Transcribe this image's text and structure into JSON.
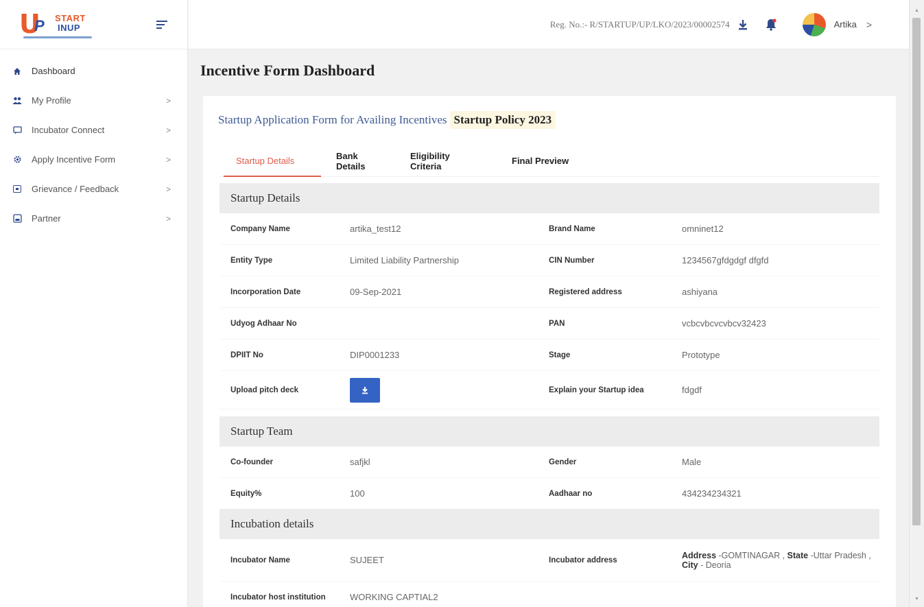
{
  "sidebar": {
    "logo": {
      "u": "U",
      "p": "P",
      "start": "START",
      "inup": "INUP"
    },
    "items": [
      {
        "label": "Dashboard",
        "icon": "home-icon",
        "has_chevron": false
      },
      {
        "label": "My Profile",
        "icon": "users-icon",
        "has_chevron": true
      },
      {
        "label": "Incubator Connect",
        "icon": "chat-icon",
        "has_chevron": true
      },
      {
        "label": "Apply Incentive Form",
        "icon": "gear-icon",
        "has_chevron": true
      },
      {
        "label": "Grievance / Feedback",
        "icon": "feedback-icon",
        "has_chevron": true
      },
      {
        "label": "Partner",
        "icon": "partner-icon",
        "has_chevron": true
      }
    ],
    "chevron": ">"
  },
  "header": {
    "reg_no": "Reg. No.:- R/STARTUP/UP/LKO/2023/00002574",
    "user_name": "Artika",
    "user_chevron": ">"
  },
  "page": {
    "title": "Incentive Form Dashboard",
    "form_title": "Startup Application Form for Availing Incentives",
    "policy": "Startup Policy 2023"
  },
  "tabs": [
    "Startup Details",
    "Bank Details",
    "Eligibility Criteria",
    "Final Preview"
  ],
  "startup_details": {
    "heading": "Startup Details",
    "rows": [
      {
        "l1": "Company Name",
        "v1": "artika_test12",
        "l2": "Brand Name",
        "v2": "omninet12"
      },
      {
        "l1": "Entity Type",
        "v1": "Limited Liability Partnership",
        "l2": "CIN Number",
        "v2": "1234567gfdgdgf dfgfd"
      },
      {
        "l1": "Incorporation Date",
        "v1": "09-Sep-2021",
        "l2": "Registered address",
        "v2": "ashiyana"
      },
      {
        "l1": "Udyog Adhaar No",
        "v1": "",
        "l2": "PAN",
        "v2": "vcbcvbcvcvbcv32423"
      },
      {
        "l1": "DPIIT No",
        "v1": "DIP0001233",
        "l2": "Stage",
        "v2": "Prototype"
      }
    ],
    "pitch_label": "Upload pitch deck",
    "idea_label": "Explain your Startup idea",
    "idea_value": "fdgdf"
  },
  "startup_team": {
    "heading": "Startup Team",
    "rows": [
      {
        "l1": "Co-founder",
        "v1": "safjkl",
        "l2": "Gender",
        "v2": "Male"
      },
      {
        "l1": "Equity%",
        "v1": "100",
        "l2": "Aadhaar no",
        "v2": "434234234321"
      }
    ]
  },
  "incubation": {
    "heading": "Incubation details",
    "name_label": "Incubator Name",
    "name_value": "SUJEET",
    "addr_label": "Incubator address",
    "addr_k1": "Address",
    "addr_v1": "-GOMTINAGAR ,",
    "addr_k2": "State",
    "addr_v2": "-Uttar Pradesh ,",
    "addr_k3": "City",
    "addr_v3": "- Deoria",
    "host_label": "Incubator host institution",
    "host_value": "WORKING CAPTIAL2"
  },
  "colors": {
    "accent": "#e05a4a",
    "primary": "#3563c4",
    "nav": "#2f4a8a",
    "title": "#3f5b94"
  }
}
